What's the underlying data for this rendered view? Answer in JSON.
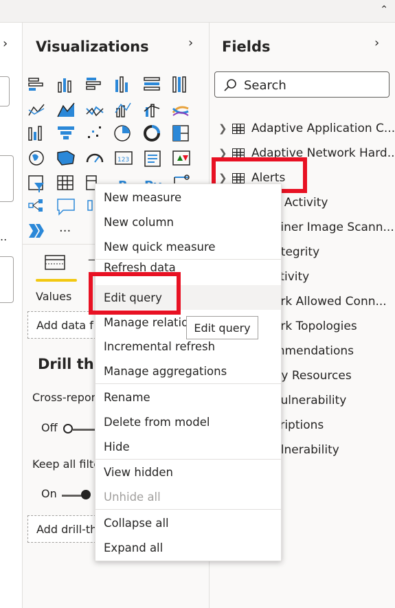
{
  "visualizations": {
    "title": "Visualizations",
    "more_label": "...",
    "tab_values": "Values",
    "add_data_fields": "Add data f",
    "drill_through_title": "Drill thr",
    "cross_report_label": "Cross-repor",
    "cross_report_state": "Off",
    "keep_filters_label": "Keep all filte",
    "keep_filters_state": "On",
    "add_drill_through": "Add drill-th"
  },
  "left_strip": {
    "ellipsis_1": "..",
    "ellipsis_2": ".."
  },
  "fields": {
    "title": "Fields",
    "search_placeholder": "Search",
    "tables": [
      "Adaptive Application C...",
      "Adaptive Network Hard...",
      "Alerts"
    ],
    "partial_items": [
      "e Activity",
      "ainer Image Scann...",
      "ntegrity",
      "ctivity",
      "ork Allowed Conn...",
      "ork Topologies",
      "mmendations",
      "ity Resources",
      "Vulnerability",
      "criptions",
      "ulnerability"
    ]
  },
  "context_menu": {
    "new_measure": "New measure",
    "new_column": "New column",
    "new_quick_measure": "New quick measure",
    "refresh_data": "Refresh data",
    "edit_query": "Edit query",
    "manage_relationships": "Manage relatio",
    "incremental_refresh": "Incremental refresh",
    "manage_aggregations": "Manage aggregations",
    "rename": "Rename",
    "delete_from_model": "Delete from model",
    "hide": "Hide",
    "view_hidden": "View hidden",
    "unhide_all": "Unhide all",
    "collapse_all": "Collapse all",
    "expand_all": "Expand all"
  },
  "tooltip": {
    "text": "Edit query"
  },
  "colors": {
    "highlight": "#e81123",
    "accent_yellow": "#f2c811",
    "icon_blue": "#2b88d8"
  }
}
